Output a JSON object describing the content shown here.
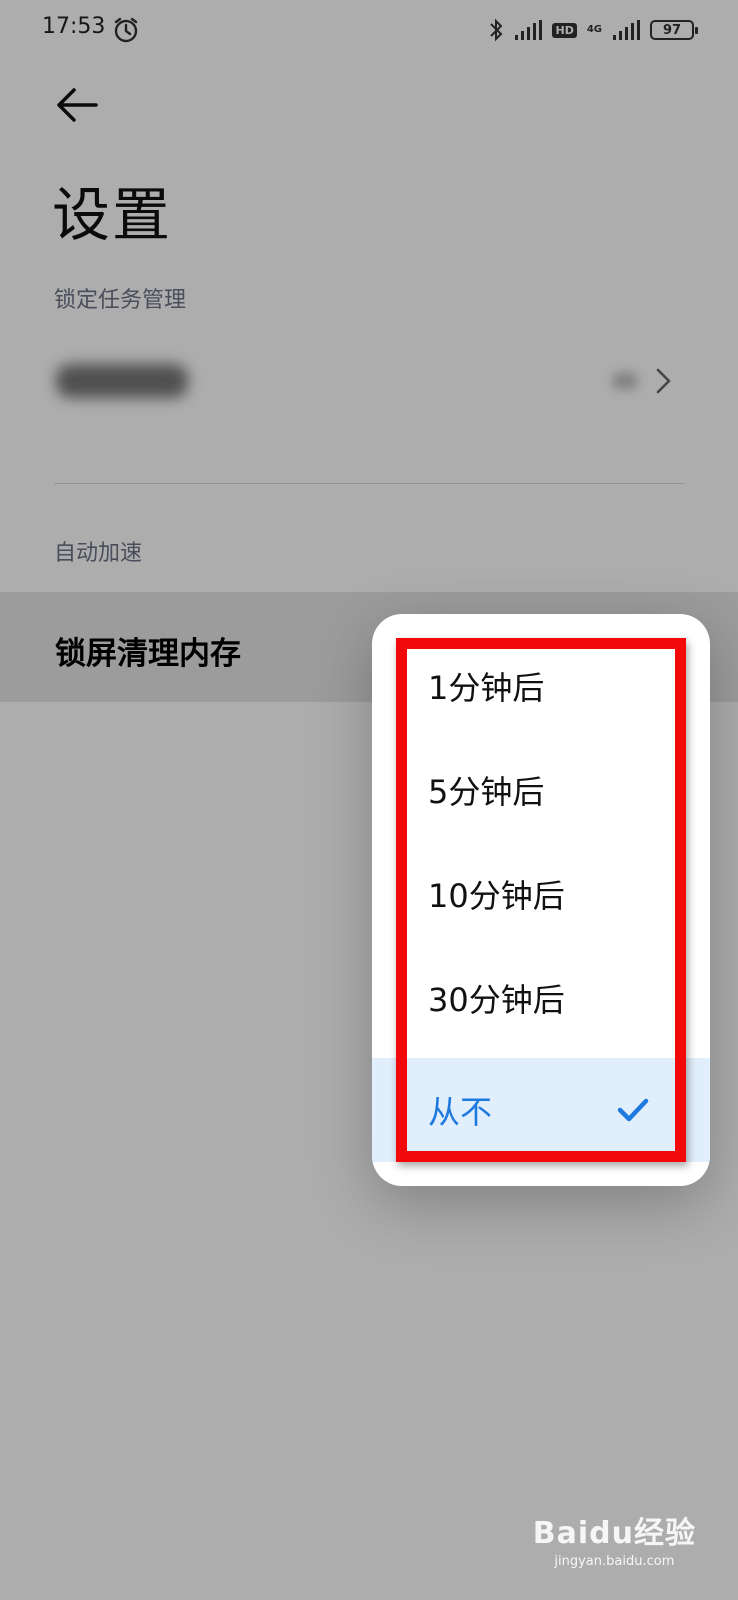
{
  "status_bar": {
    "time": "17:53",
    "hd": "HD",
    "network": "4G",
    "battery": "97"
  },
  "page": {
    "title": "设置",
    "section_lock": "锁定任务管理",
    "section_auto": "自动加速",
    "lock_clean_label": "锁屏清理内存"
  },
  "popup": {
    "options": [
      {
        "label": "1分钟后",
        "selected": false
      },
      {
        "label": "5分钟后",
        "selected": false
      },
      {
        "label": "10分钟后",
        "selected": false
      },
      {
        "label": "30分钟后",
        "selected": false
      },
      {
        "label": "从不",
        "selected": true
      }
    ]
  },
  "colors": {
    "accent": "#1f7ae0",
    "highlight_frame": "#f20a0a",
    "selected_bg": "#e1eefb"
  },
  "watermark": {
    "brand": "Baidu经验",
    "url": "jingyan.baidu.com"
  }
}
